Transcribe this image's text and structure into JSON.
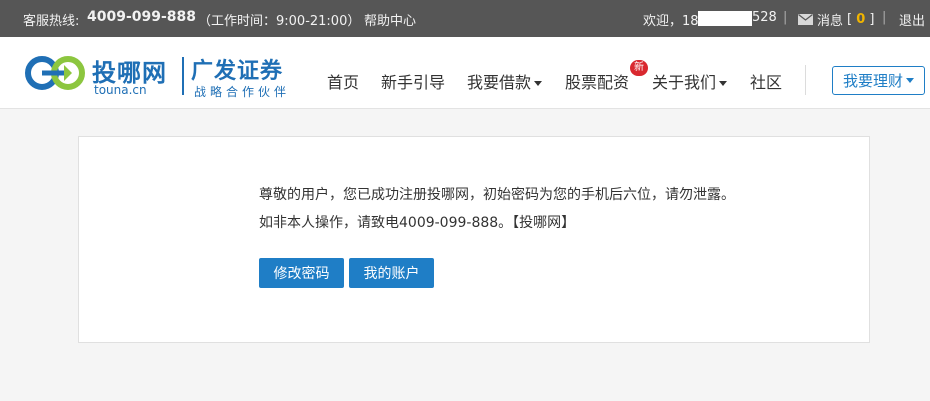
{
  "topbar": {
    "hotline_label": "客服热线:",
    "hotline_number": "4009-099-888",
    "hours": "（工作时间：9:00-21:00）",
    "help": "帮助中心",
    "welcome_prefix": "欢迎，18",
    "welcome_suffix": "528",
    "messages_label": "消息",
    "messages_count": "0",
    "logout": "退出",
    "separator": "|"
  },
  "logo": {
    "name": "投哪网",
    "domain": "touna.cn",
    "partner": "广发证券",
    "partner_sub": "战略合作伙伴"
  },
  "nav": {
    "items": [
      {
        "label": "首页"
      },
      {
        "label": "新手引导"
      },
      {
        "label": "我要借款"
      },
      {
        "label": "股票配资"
      },
      {
        "label": "关于我们"
      },
      {
        "label": "社区"
      }
    ],
    "new_badge": "新",
    "invest_button": "我要理财"
  },
  "content": {
    "message_line1": "尊敬的用户，您已成功注册投哪网，初始密码为您的手机后六位，请勿泄露。",
    "message_line2": "如非本人操作，请致电4009-099-888。【投哪网】",
    "change_password_button": "修改密码",
    "my_account_button": "我的账户"
  },
  "colors": {
    "brand_blue": "#1f6fb5",
    "button_blue": "#1f7ec6",
    "topbar_bg": "#565656",
    "badge_red": "#d9282f",
    "count_yellow": "#f0b400"
  }
}
